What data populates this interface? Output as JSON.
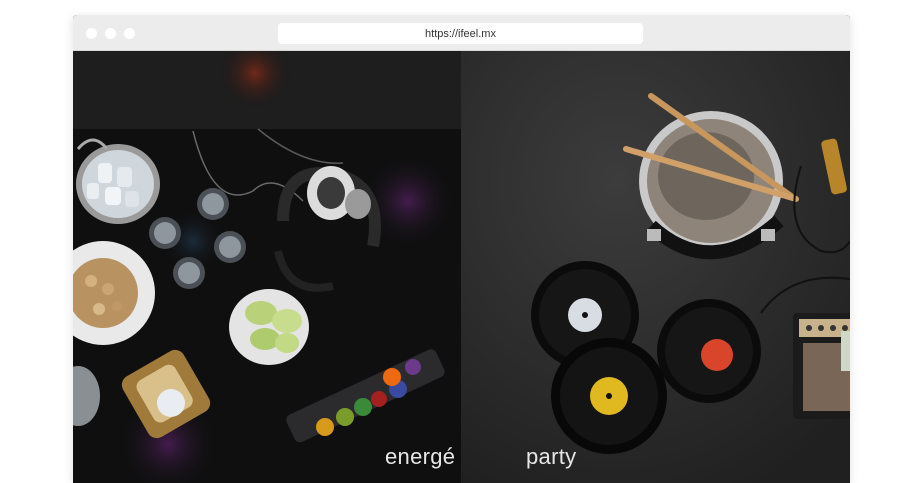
{
  "browser": {
    "url": "https://ifeel.mx"
  },
  "panels": {
    "left": {
      "caption": "energé"
    },
    "right": {
      "caption": "party"
    }
  },
  "colors": {
    "left_bg": "#141414",
    "right_bg": "#2e2e2e",
    "chrome": "#ececec"
  }
}
